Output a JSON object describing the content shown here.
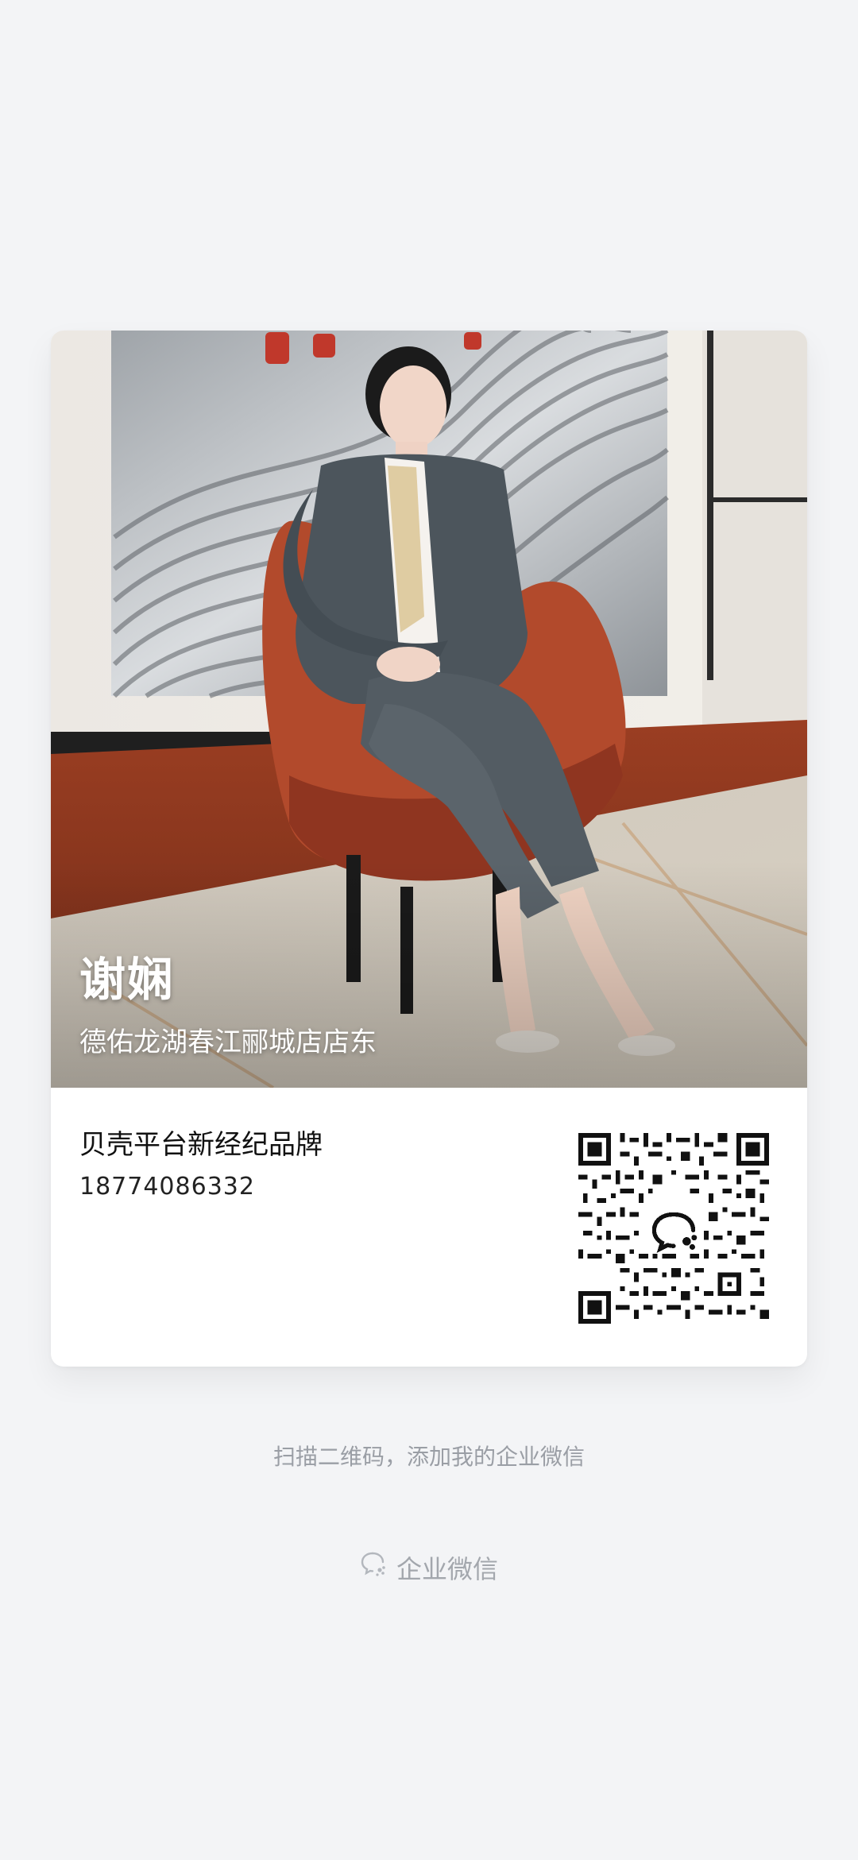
{
  "profile": {
    "name": "谢娴",
    "company": "德佑龙湖春江郦城店店东",
    "brand": "贝壳平台新经纪品牌",
    "phone": "18774086332"
  },
  "qr": {
    "label": "企业微信二维码"
  },
  "hint": "扫描二维码，添加我的企业微信",
  "footer": {
    "icon": "wecom-icon",
    "label": "企业微信"
  }
}
